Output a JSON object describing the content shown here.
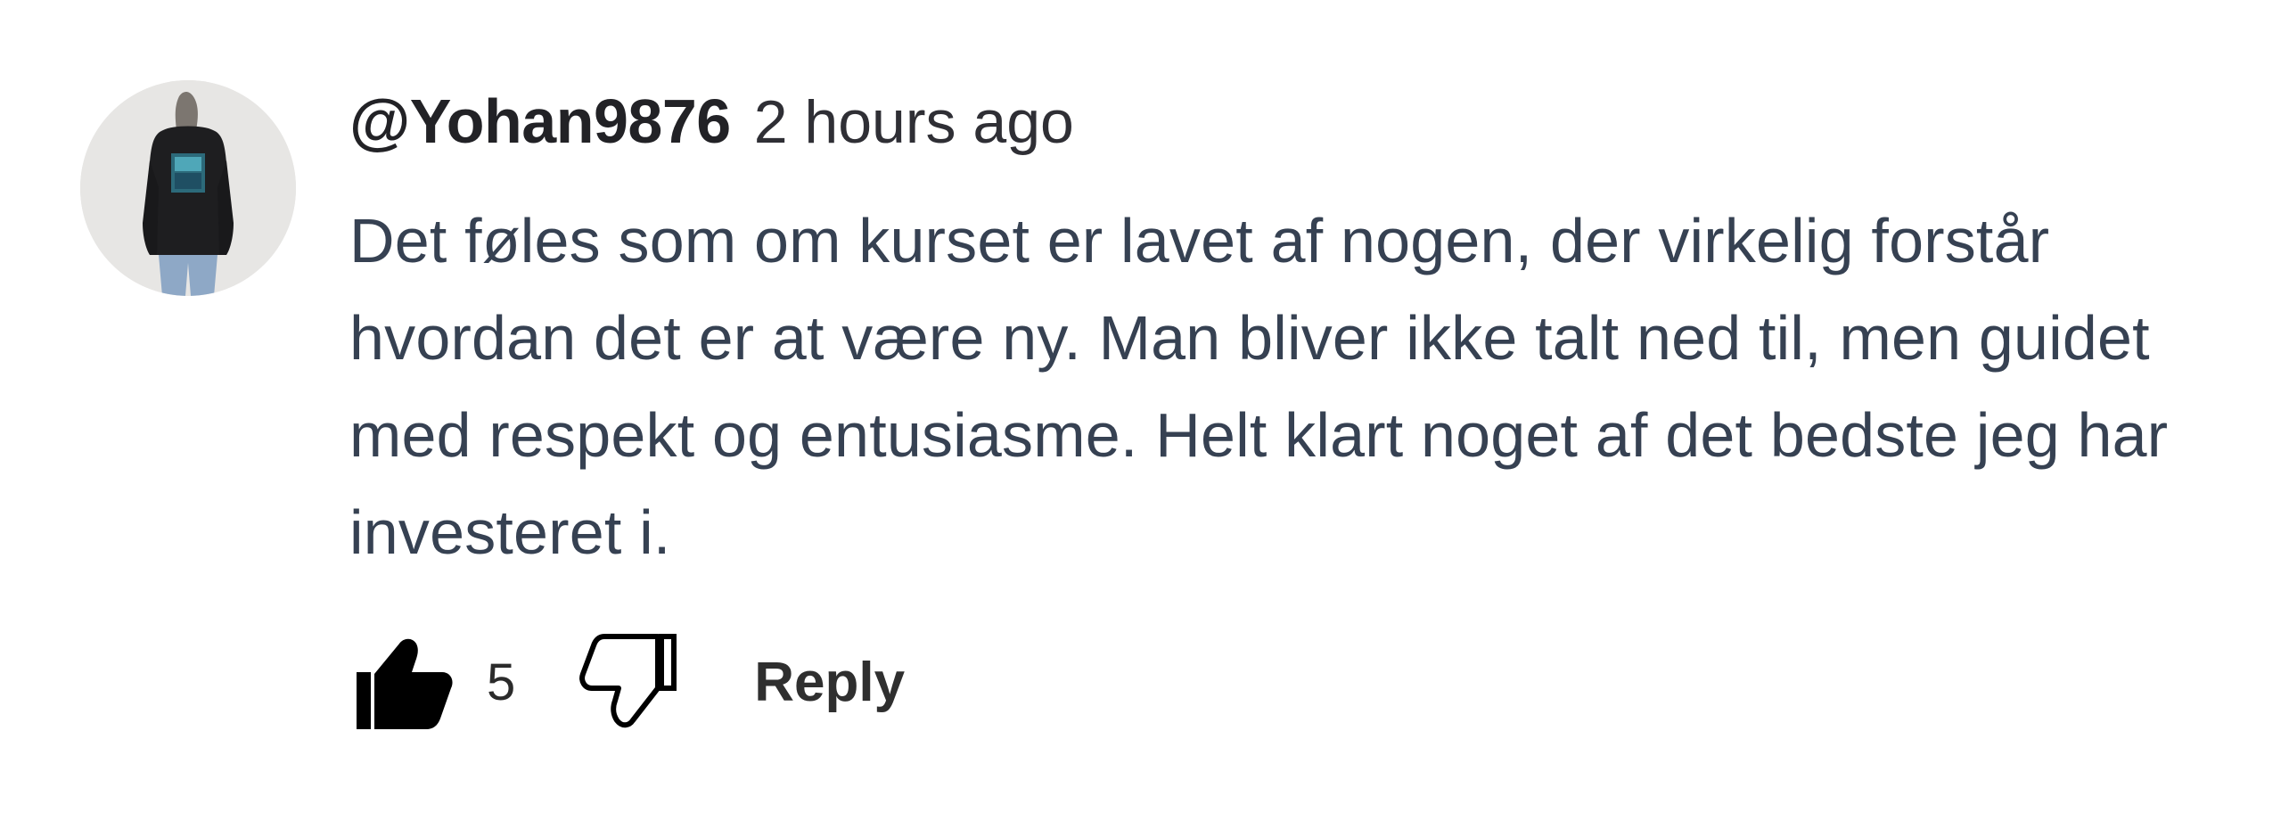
{
  "comment": {
    "username": "@Yohan9876",
    "timestamp": "2 hours ago",
    "text": "Det føles som om kurset er lavet af nogen, der virkelig forstår hvordan det er at være ny. Man bliver ikke talt ned til, men guidet med respekt og entusiasme. Helt klart noget af det bedste jeg har investeret i.",
    "avatar": {
      "icon": "user-avatar-photo",
      "background_color": "#e6e5e3"
    }
  },
  "actions": {
    "like_icon": "thumbs-up-icon",
    "like_count": "5",
    "dislike_icon": "thumbs-down-icon",
    "reply_label": "Reply"
  },
  "colors": {
    "username": "#222226",
    "text": "#364152",
    "icon": "#000000"
  }
}
